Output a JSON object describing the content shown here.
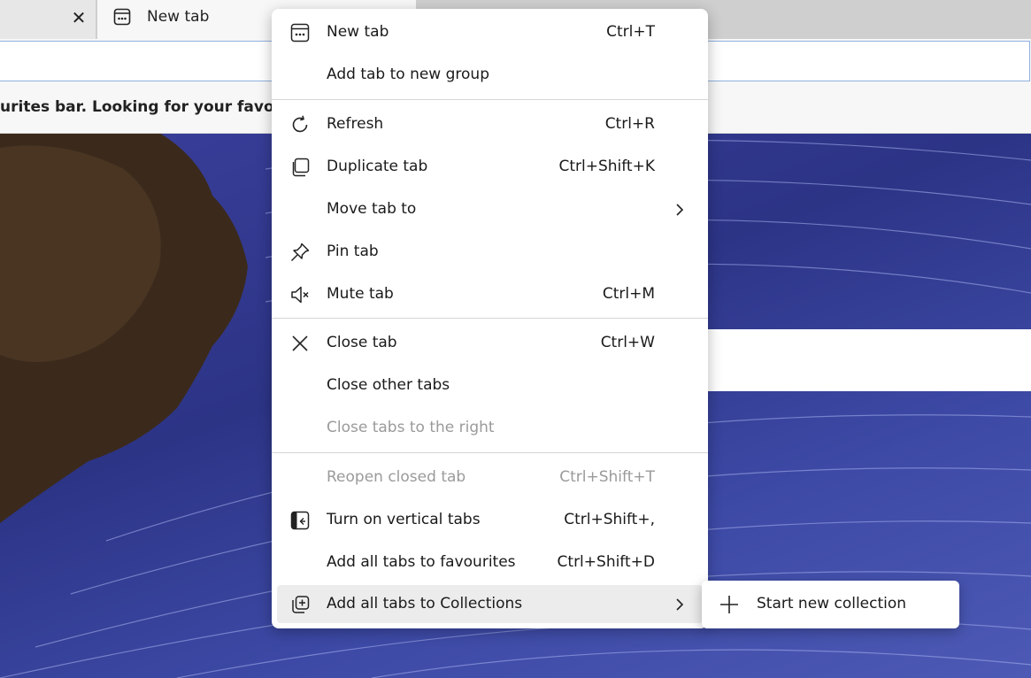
{
  "tabs": {
    "previous_close": "✕",
    "active_title": "New tab"
  },
  "favourites_bar": {
    "text": "urites bar. Looking for your favourites"
  },
  "context_menu": {
    "items": [
      {
        "label": "New tab",
        "shortcut": "Ctrl+T",
        "icon": "new-tab-icon"
      },
      {
        "label": "Add tab to new group",
        "shortcut": ""
      },
      {
        "label": "Refresh",
        "shortcut": "Ctrl+R",
        "icon": "refresh-icon"
      },
      {
        "label": "Duplicate tab",
        "shortcut": "Ctrl+Shift+K",
        "icon": "duplicate-icon"
      },
      {
        "label": "Move tab to",
        "shortcut": "",
        "submenu": true
      },
      {
        "label": "Pin tab",
        "shortcut": "",
        "icon": "pin-icon"
      },
      {
        "label": "Mute tab",
        "shortcut": "Ctrl+M",
        "icon": "mute-icon"
      },
      {
        "label": "Close tab",
        "shortcut": "Ctrl+W",
        "icon": "close-icon"
      },
      {
        "label": "Close other tabs",
        "shortcut": ""
      },
      {
        "label": "Close tabs to the right",
        "shortcut": "",
        "disabled": true
      },
      {
        "label": "Reopen closed tab",
        "shortcut": "Ctrl+Shift+T",
        "disabled": true
      },
      {
        "label": "Turn on vertical tabs",
        "shortcut": "Ctrl+Shift+,",
        "icon": "vertical-tabs-icon"
      },
      {
        "label": "Add all tabs to favourites",
        "shortcut": "Ctrl+Shift+D"
      },
      {
        "label": "Add all tabs to Collections",
        "shortcut": "",
        "icon": "collections-icon",
        "submenu": true,
        "hovered": true
      }
    ]
  },
  "submenu": {
    "label": "Start new collection",
    "icon": "plus-icon"
  }
}
